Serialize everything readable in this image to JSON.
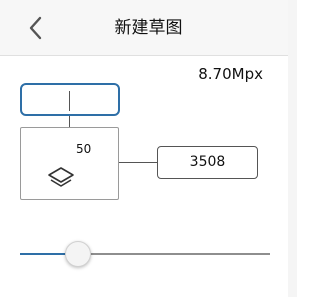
{
  "header": {
    "title": "新建草图",
    "back_icon": "chevron-left-icon"
  },
  "canvas": {
    "megapixels_label": "8.70Mpx",
    "width_value": "",
    "height_value": "3508",
    "layer_count": "50",
    "layer_icon": "layers-icon"
  },
  "slider": {
    "value_fraction": 0.23
  },
  "colors": {
    "accent": "#2e6fa7",
    "header_bg": "#f7f7f7"
  }
}
